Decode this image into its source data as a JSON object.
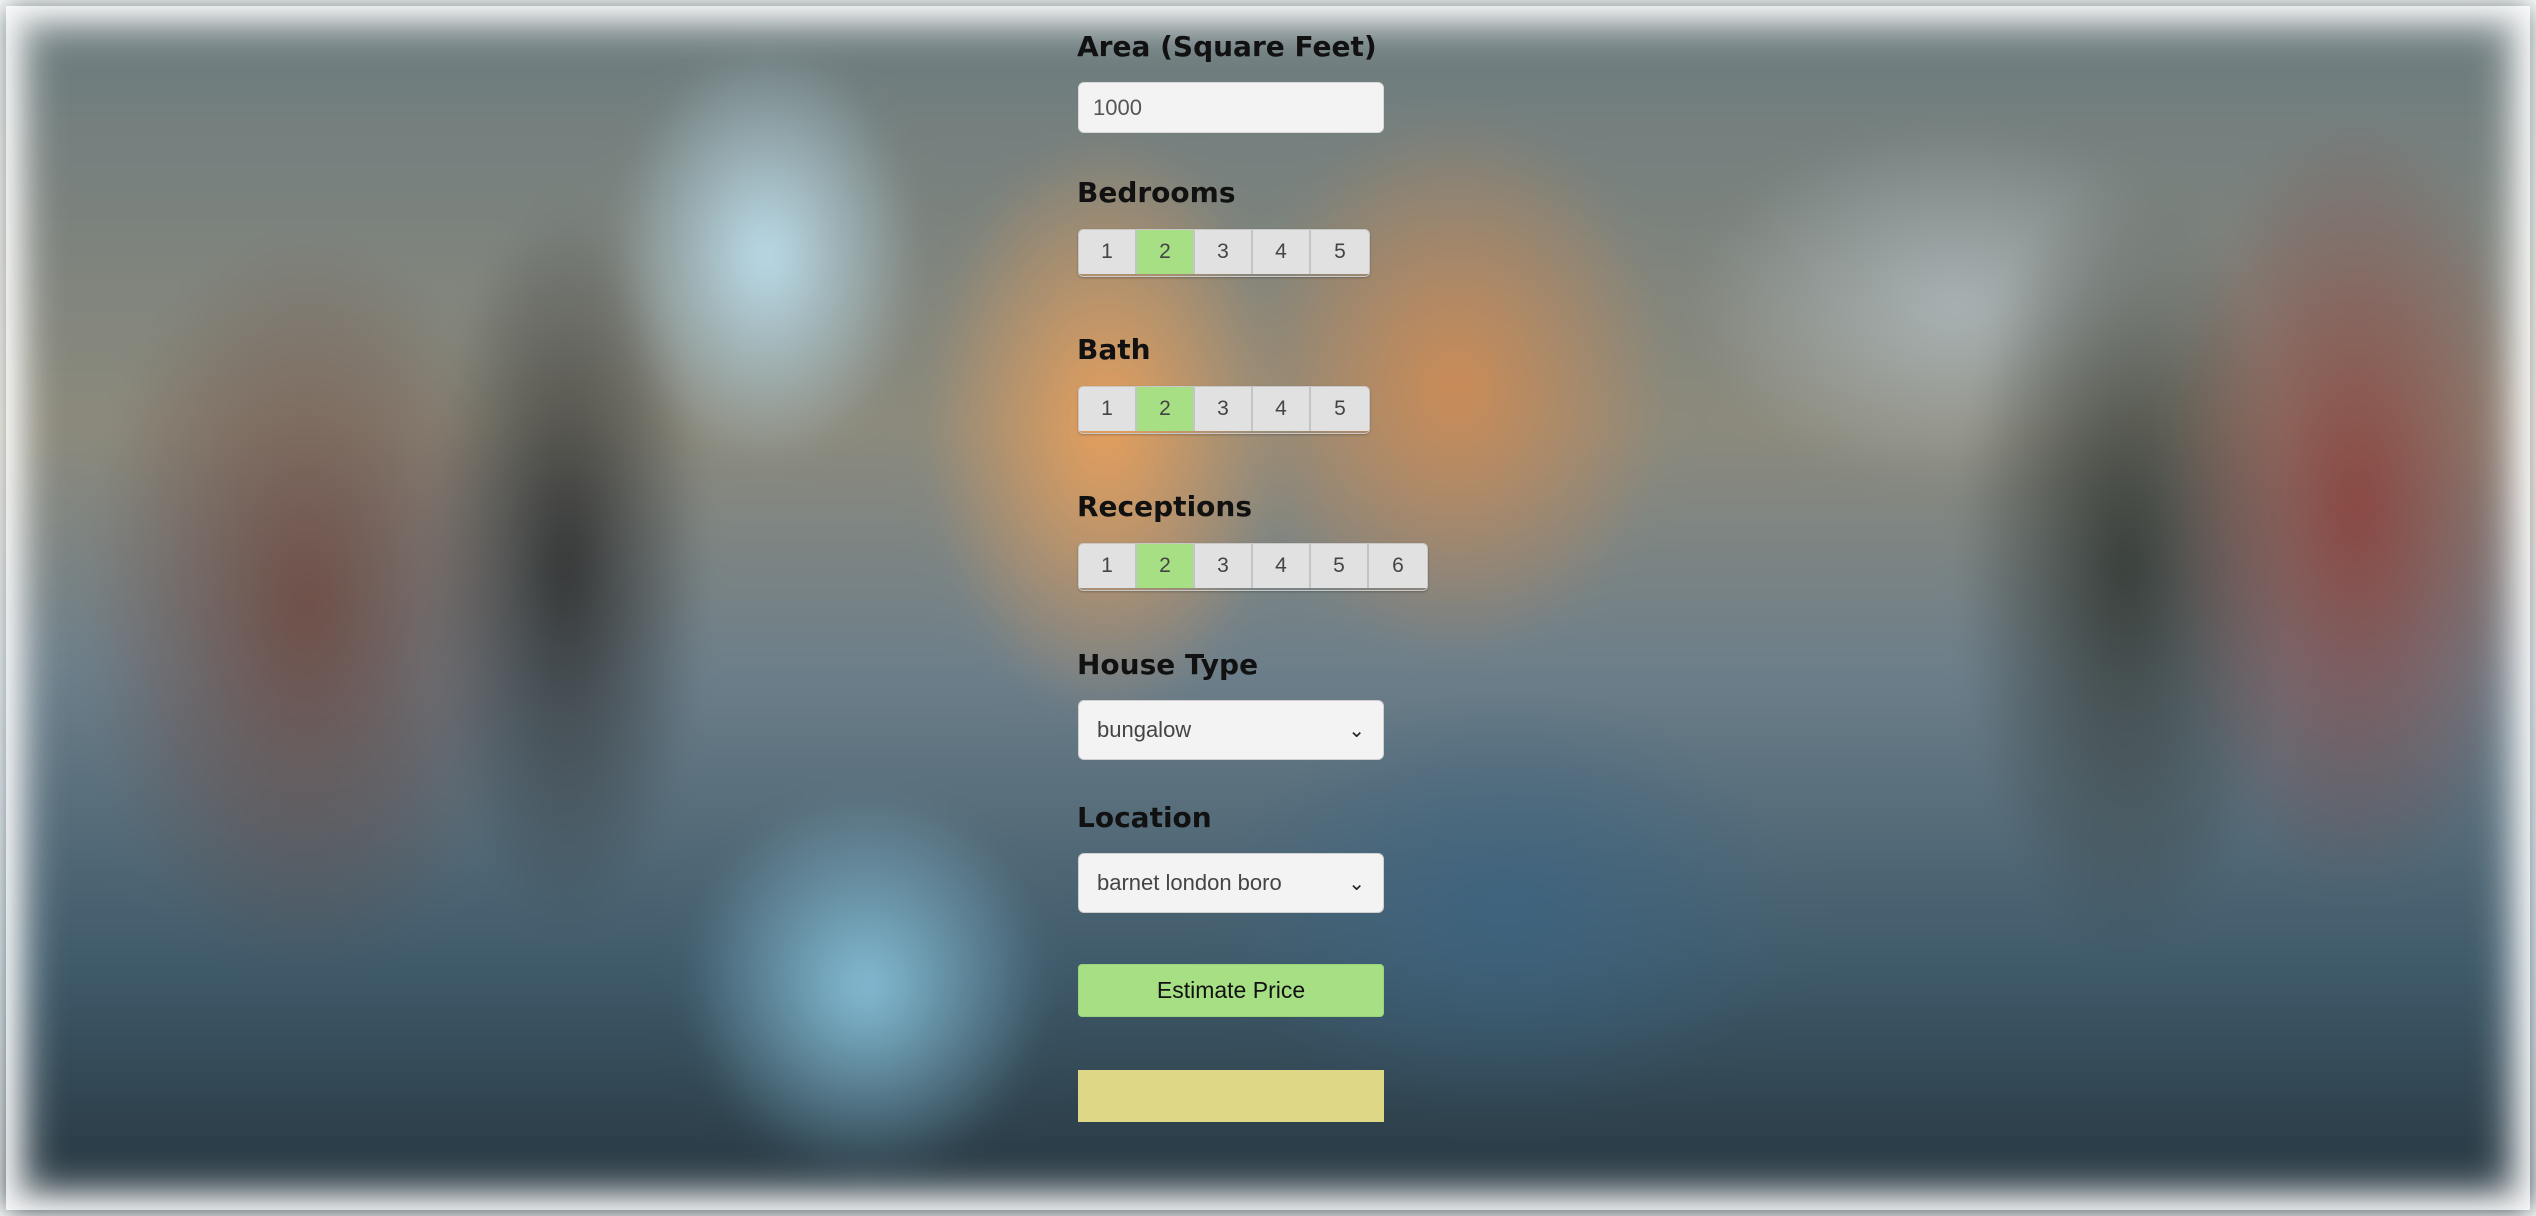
{
  "colors": {
    "selected": "#a6df84",
    "button": "#a6df84",
    "result_box": "#ddd786",
    "option_bg": "#e1e1e1"
  },
  "area": {
    "label": "Area (Square Feet)",
    "value": "1000"
  },
  "bedrooms": {
    "label": "Bedrooms",
    "options": [
      "1",
      "2",
      "3",
      "4",
      "5"
    ],
    "selected": "2"
  },
  "bath": {
    "label": "Bath",
    "options": [
      "1",
      "2",
      "3",
      "4",
      "5"
    ],
    "selected": "2"
  },
  "receptions": {
    "label": "Receptions",
    "options": [
      "1",
      "2",
      "3",
      "4",
      "5",
      "6"
    ],
    "selected": "2"
  },
  "house_type": {
    "label": "House Type",
    "selected": "bungalow",
    "icon": "chevron-down-icon"
  },
  "location": {
    "label": "Location",
    "selected": "barnet london boro",
    "icon": "chevron-down-icon"
  },
  "estimate_button": {
    "label": "Estimate Price"
  },
  "result": {
    "text": ""
  }
}
